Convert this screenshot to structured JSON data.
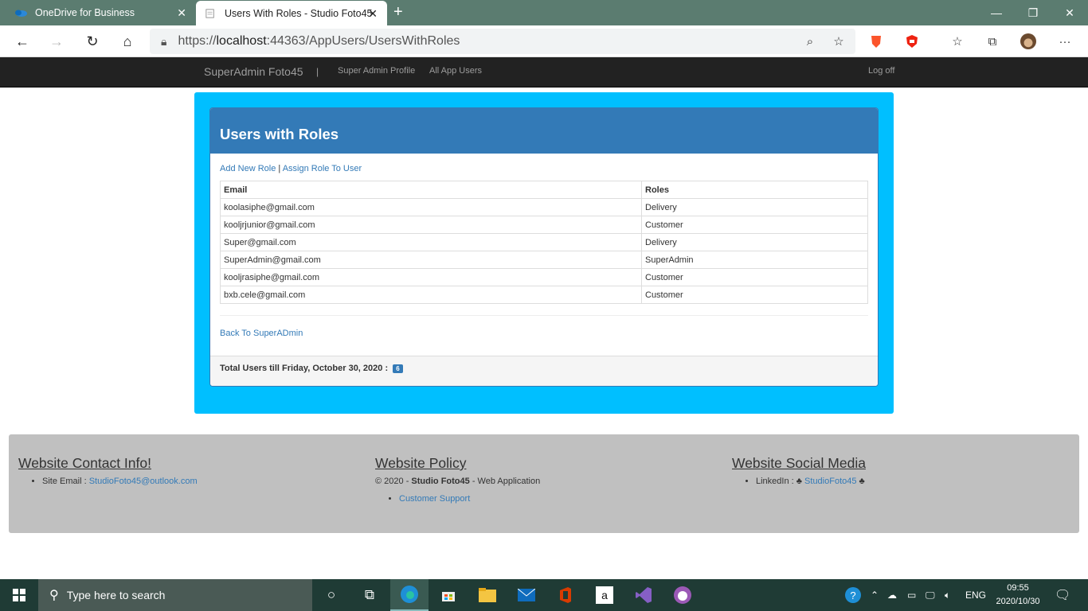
{
  "browser": {
    "tabs": [
      {
        "title": "OneDrive for Business"
      },
      {
        "title": "Users With Roles - Studio Foto45"
      }
    ],
    "url_prefix": "https://",
    "url_host": "localhost",
    "url_rest": ":44363/AppUsers/UsersWithRoles"
  },
  "nav": {
    "brand": "SuperAdmin Foto45",
    "separator": "|",
    "links": [
      "Super Admin Profile",
      "All App Users"
    ],
    "logoff": "Log off"
  },
  "panel": {
    "title": "Users with Roles",
    "actions": {
      "add_role": "Add New Role",
      "pipe": "|",
      "assign_role": "Assign Role To User"
    },
    "table": {
      "headers": [
        "Email",
        "Roles"
      ],
      "rows": [
        [
          "koolasiphe@gmail.com",
          "Delivery"
        ],
        [
          "kooljrjunior@gmail.com",
          "Customer"
        ],
        [
          "Super@gmail.com",
          "Delivery"
        ],
        [
          "SuperAdmin@gmail.com",
          "SuperAdmin"
        ],
        [
          "kooljrasiphe@gmail.com",
          "Customer"
        ],
        [
          "bxb.cele@gmail.com",
          "Customer"
        ]
      ]
    },
    "back_link": "Back To SuperADmin",
    "footer_text": "Total Users till Friday, October 30, 2020 :",
    "user_count": "6"
  },
  "footer": {
    "contact": {
      "heading": "Website Contact Info!",
      "label": "Site Email :",
      "email": "StudioFoto45@outlook.com"
    },
    "policy": {
      "heading": "Website Policy",
      "copyright_prefix": "© 2020 -",
      "company": "Studio Foto45",
      "suffix": "- Web Application",
      "support": "Customer Support"
    },
    "social": {
      "heading": "Website Social Media",
      "label": "LinkedIn :",
      "club1": "♣",
      "link": "StudioFoto45",
      "club2": "♣"
    }
  },
  "taskbar": {
    "search_placeholder": "Type here to search",
    "language": "ENG",
    "time": "09:55",
    "date": "2020/10/30"
  },
  "colors": {
    "accent": "#337ab7",
    "outer_box": "#00bfff",
    "navbar": "#222222",
    "footer": "#c0c0c0"
  }
}
